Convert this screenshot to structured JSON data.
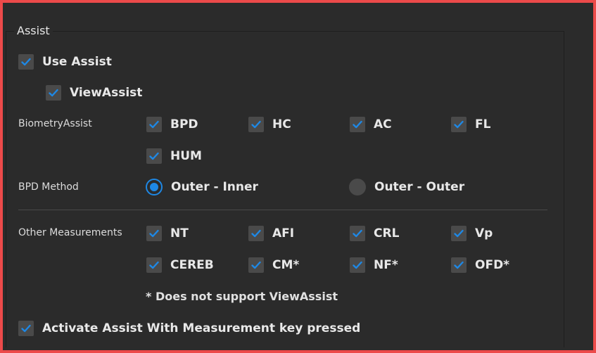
{
  "group": {
    "title": "Assist"
  },
  "use_assist": {
    "label": "Use Assist",
    "checked": true
  },
  "view_assist": {
    "label": "ViewAssist",
    "checked": true
  },
  "biometry": {
    "row_label": "BiometryAssist",
    "items": [
      {
        "label": "BPD",
        "checked": true
      },
      {
        "label": "HC",
        "checked": true
      },
      {
        "label": "AC",
        "checked": true
      },
      {
        "label": "FL",
        "checked": true
      },
      {
        "label": "HUM",
        "checked": true
      }
    ]
  },
  "bpd_method": {
    "row_label": "BPD Method",
    "options": [
      {
        "label": "Outer - Inner",
        "selected": true
      },
      {
        "label": "Outer - Outer",
        "selected": false
      }
    ]
  },
  "other": {
    "row_label": "Other Measurements",
    "items": [
      {
        "label": "NT",
        "checked": true
      },
      {
        "label": "AFI",
        "checked": true
      },
      {
        "label": "CRL",
        "checked": true
      },
      {
        "label": "Vp",
        "checked": true
      },
      {
        "label": "CEREB",
        "checked": true
      },
      {
        "label": "CM*",
        "checked": true
      },
      {
        "label": "NF*",
        "checked": true
      },
      {
        "label": "OFD*",
        "checked": true
      }
    ]
  },
  "note": "* Does not support ViewAssist",
  "activate": {
    "label": "Activate Assist With Measurement key pressed",
    "checked": true
  },
  "colors": {
    "accent": "#1e88e5",
    "border": "#ec4a4a",
    "background": "#2b2b2b"
  },
  "icons": {
    "check": "checkmark-icon",
    "radio": "radio-dot-icon"
  }
}
